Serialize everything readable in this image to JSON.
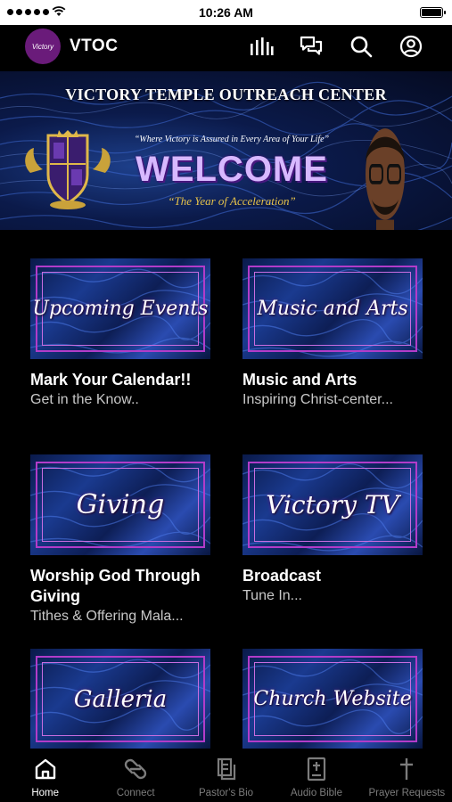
{
  "status_bar": {
    "time": "10:26 AM"
  },
  "header": {
    "logo_text": "Victory",
    "title": "VTOC",
    "icons": [
      "equalizer-icon",
      "chat-icon",
      "search-icon",
      "account-icon"
    ]
  },
  "banner": {
    "title": "VICTORY TEMPLE OUTREACH CENTER",
    "tagline": "“Where Victory is Assured in Every Area of Your Life”",
    "welcome": "WELCOME",
    "motto": "“The Year of Acceleration”"
  },
  "tiles": [
    {
      "image_text": "Upcoming Events",
      "title": "Mark Your Calendar!!",
      "subtitle": "Get in the Know.."
    },
    {
      "image_text": "Music and Arts",
      "title": "Music and Arts",
      "subtitle": "Inspiring Christ-center..."
    },
    {
      "image_text": "Giving",
      "title": "Worship God Through Giving",
      "subtitle": "Tithes & Offering Mala..."
    },
    {
      "image_text": "Victory TV",
      "title": "Broadcast",
      "subtitle": "Tune In..."
    },
    {
      "image_text": "Galleria",
      "title": "",
      "subtitle": ""
    },
    {
      "image_text": "Church Website",
      "title": "",
      "subtitle": ""
    }
  ],
  "tabbar": {
    "items": [
      {
        "label": "Home",
        "icon": "home-icon",
        "active": true
      },
      {
        "label": "Connect",
        "icon": "connect-icon",
        "active": false
      },
      {
        "label": "Pastor's Bio",
        "icon": "book-icon",
        "active": false
      },
      {
        "label": "Audio Bible",
        "icon": "bible-icon",
        "active": false
      },
      {
        "label": "Prayer Requests",
        "icon": "cross-icon",
        "active": false
      }
    ]
  },
  "colors": {
    "background": "#000000",
    "frame_purple": "#b23cc9",
    "welcome_lavender": "#d7b8ff",
    "motto_gold": "#e6c24a",
    "tab_inactive": "#7c7c7c"
  }
}
